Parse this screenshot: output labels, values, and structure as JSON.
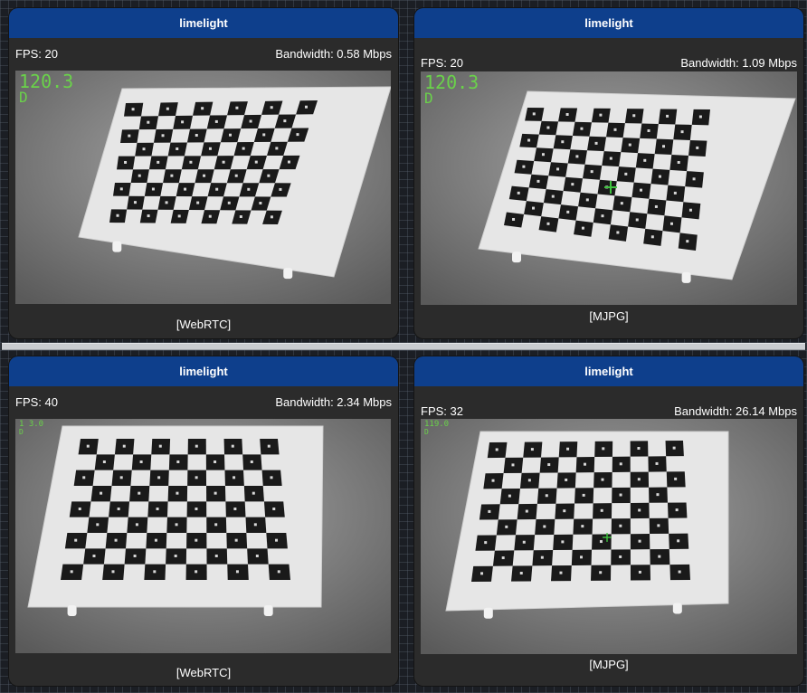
{
  "panels": [
    {
      "title": "limelight",
      "fps": "FPS: 20",
      "bandwidth": "Bandwidth: 0.58 Mbps",
      "stream": "[WebRTC]",
      "overlay_value": "120.3",
      "overlay_mode": "D"
    },
    {
      "title": "limelight",
      "fps": "FPS: 20",
      "bandwidth": "Bandwidth: 1.09 Mbps",
      "stream": "[MJPG]",
      "overlay_value": "120.3",
      "overlay_mode": "D"
    },
    {
      "title": "limelight",
      "fps": "FPS: 40",
      "bandwidth": "Bandwidth: 2.34 Mbps",
      "stream": "[WebRTC]",
      "overlay_value": "1 3.0",
      "overlay_mode": "D"
    },
    {
      "title": "limelight",
      "fps": "FPS: 32",
      "bandwidth": "Bandwidth: 26.14 Mbps",
      "stream": "[MJPG]",
      "overlay_value": "119.0",
      "overlay_mode": "D"
    }
  ],
  "colors": {
    "header_blue": "#0e3f8c",
    "panel_bg": "#2b2b2b",
    "overlay_green": "#6ad24a"
  }
}
